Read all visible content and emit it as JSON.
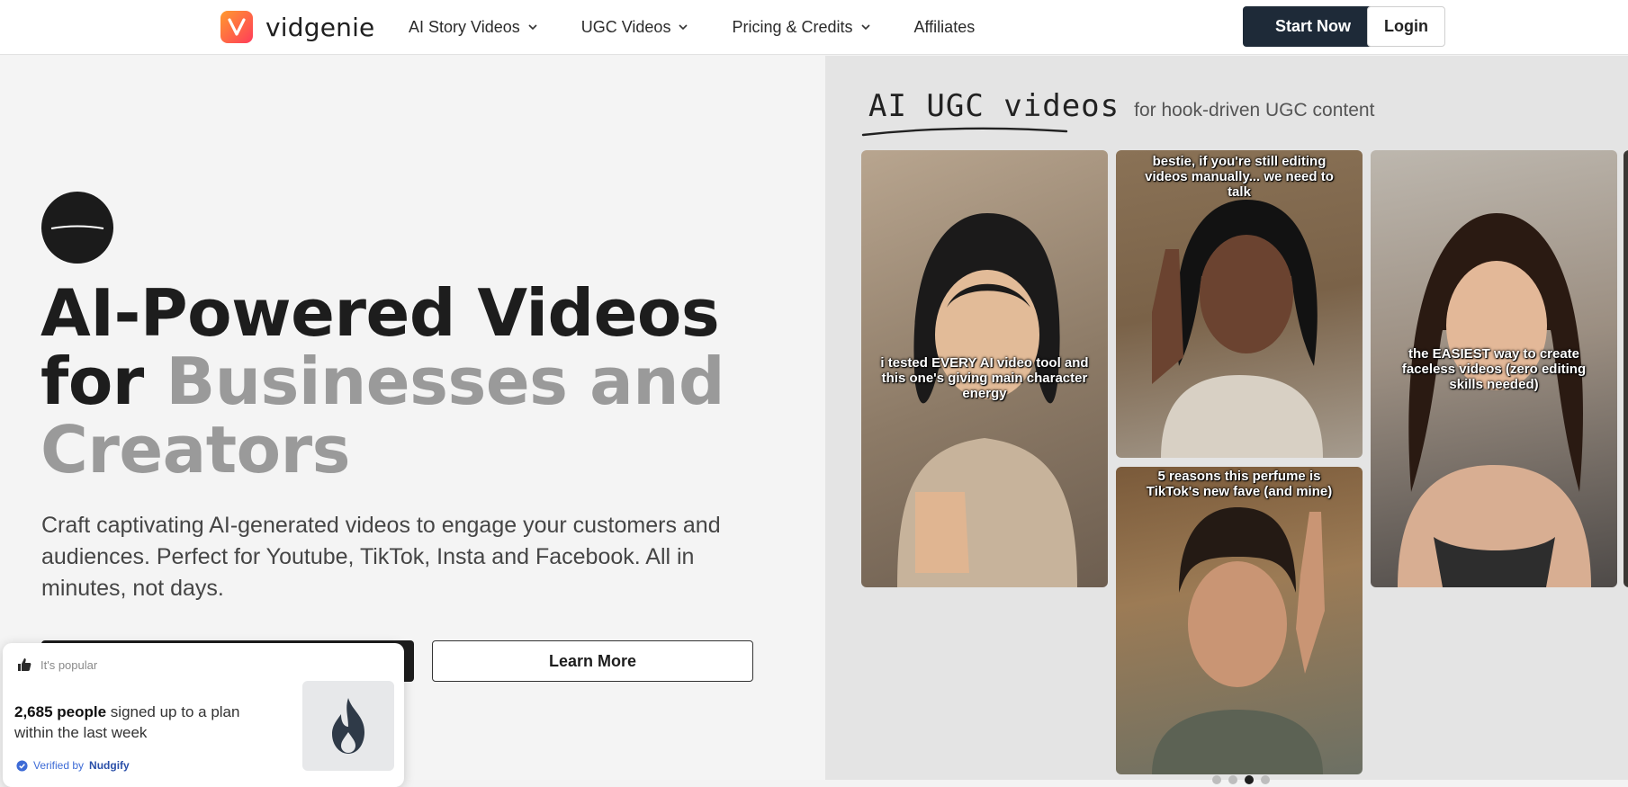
{
  "brand": {
    "name": "vidgenie",
    "logo_letter": "V"
  },
  "nav": {
    "items": [
      {
        "label": "AI Story Videos",
        "has_dropdown": true
      },
      {
        "label": "UGC Videos",
        "has_dropdown": true
      },
      {
        "label": "Pricing & Credits",
        "has_dropdown": true
      },
      {
        "label": "Affiliates",
        "has_dropdown": false
      }
    ],
    "start_label": "Start Now",
    "login_label": "Login"
  },
  "hero": {
    "headline_line1": "AI-Powered Videos",
    "headline_for": "for ",
    "headline_muted1": "Businesses and",
    "headline_muted2": "Creators",
    "subtext": "Craft captivating AI-generated videos to engage your customers and audiences. Perfect for Youtube, TikTok, Insta and Facebook. All in minutes, not days.",
    "learn_more_label": "Learn More"
  },
  "popup": {
    "tag": "It's popular",
    "count": "2,685 people",
    "message_rest": " signed up to a plan within the last week",
    "verified_prefix": "Verified by ",
    "verified_brand": "Nudgify"
  },
  "showcase": {
    "title_script": "AI UGC videos",
    "title_sub": "for hook-driven UGC content",
    "cards": [
      {
        "caption": "i tested EVERY AI video tool and this one's giving main character energy"
      },
      {
        "caption": "bestie, if you're still editing videos manually... we need to talk"
      },
      {
        "caption": "the EASIEST way to create faceless videos (zero editing skills needed)"
      },
      {
        "caption": "5 reasons this perfume is TikTok's new fave (and mine)"
      }
    ]
  },
  "colors": {
    "primary_dark": "#1e2a38",
    "muted_text": "#9a9a9a",
    "logo_gradient_start": "#ff9a2e",
    "logo_gradient_end": "#ff3c5a",
    "verified_blue": "#3d6bd6"
  },
  "icons": {
    "nav_dropdown": "chevron-down-icon",
    "popup_tag": "thumbs-up-icon",
    "popup_verified": "check-badge-icon",
    "popup_visual": "flame-icon"
  }
}
